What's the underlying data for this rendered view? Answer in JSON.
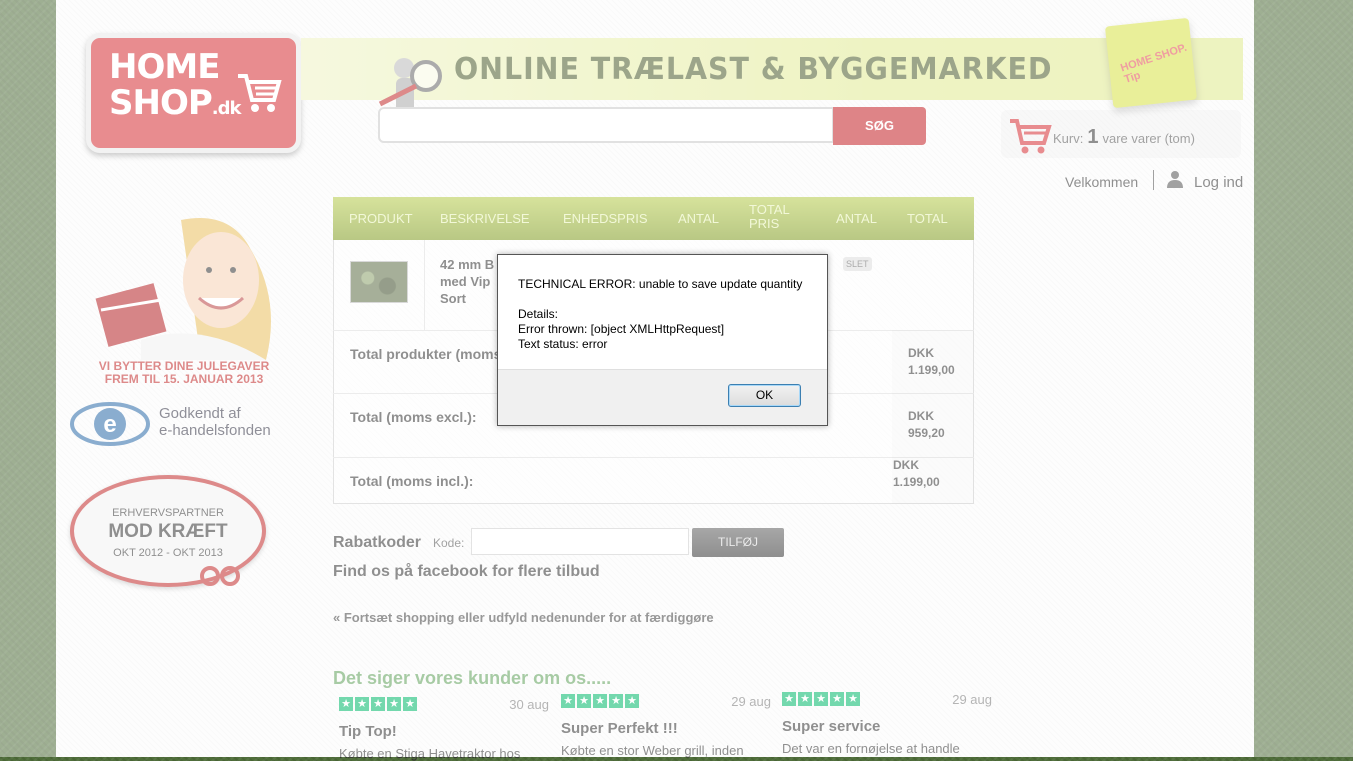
{
  "header": {
    "logo_line1": "HOME",
    "logo_line2": "SHOP",
    "logo_suffix": ".dk",
    "banner_title": "ONLINE TRÆLAST & BYGGEMARKED",
    "bag_text": "HOME SHOP. Tip",
    "search_button": "SØG",
    "basket_prefix": "Kurv:",
    "basket_count": "1",
    "basket_suffix": "vare varer (tom)",
    "welcome": "Velkommen",
    "login": "Log ind"
  },
  "sidebar": {
    "xmas_line1": "VI BYTTER DINE JULEGAVER",
    "xmas_line2": "FREM TIL 15. JANUAR 2013",
    "ehandel_line1": "Godkendt af",
    "ehandel_line2": "e-handelsfonden",
    "badge_top": "ERHVERVSPARTNER",
    "badge_main": "MOD KRÆFT",
    "badge_bottom": "OKT 2012 - OKT 2013"
  },
  "cart": {
    "columns": [
      "PRODUKT",
      "BESKRIVELSE",
      "ENHEDSPRIS",
      "ANTAL",
      "TOTAL PRIS",
      "ANTAL",
      "TOTAL"
    ],
    "product_line1": "42 mm B",
    "product_line2": "med Vip",
    "product_line3": "Sort",
    "delete_label": "SLET",
    "totals": [
      {
        "label": "Total produkter (moms",
        "currency": "DKK",
        "value": "1.199,00"
      },
      {
        "label": "Total (moms excl.):",
        "currency": "DKK",
        "value": "959,20"
      },
      {
        "label": "Total (moms incl.):",
        "currency": "DKK",
        "value": "1.199,00"
      }
    ]
  },
  "discount": {
    "title": "Rabatkoder",
    "code_label": "Kode:",
    "code_value": "",
    "add_button": "TILFØJ"
  },
  "facebook_text": "Find os på facebook for flere tilbud",
  "continue_link": "« Fortsæt shopping",
  "continue_rest": "eller udfyld nedenunder for at færdiggøre",
  "reviews": {
    "title": "Det siger vores kunder om os.....",
    "items": [
      {
        "date": "30 aug",
        "title": "Tip Top!",
        "text": "Købte en Stiga Havetraktor hos"
      },
      {
        "date": "29 aug",
        "title": "Super Perfekt !!!",
        "text": "Købte en stor Weber grill, inden"
      },
      {
        "date": "29 aug",
        "title": "Super service",
        "text": "Det var en fornøjelse at handle"
      }
    ]
  },
  "dialog": {
    "line1": "TECHNICAL ERROR: unable to save update quantity",
    "line2": "Details:",
    "line3": "Error thrown: [object XMLHttpRequest]",
    "line4": "Text status: error",
    "ok_button": "OK"
  },
  "colors": {
    "brand_red": "#d62f33",
    "header_green": "#8ea82a",
    "review_green": "#00b86b"
  }
}
